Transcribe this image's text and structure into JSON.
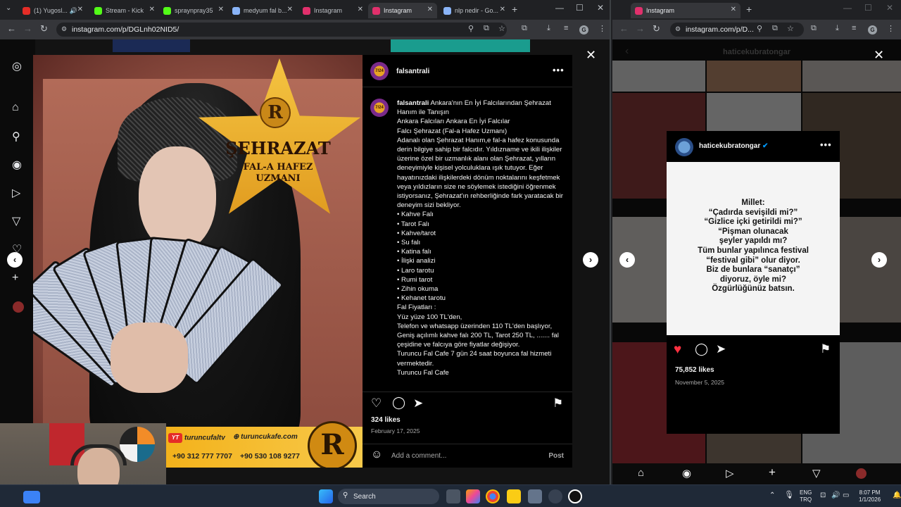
{
  "left_window": {
    "tabs": [
      {
        "label": "(1) Yugosl...",
        "color": "#e52d27",
        "audio": "🔊"
      },
      {
        "label": "Stream - Kick",
        "color": "#53fc18"
      },
      {
        "label": "spraynpray35",
        "color": "#53fc18"
      },
      {
        "label": "medyum fal b...",
        "color": "#8ab4f8"
      },
      {
        "label": "Instagram",
        "color": "#e1306c"
      },
      {
        "label": "Instagram",
        "color": "#e1306c"
      },
      {
        "label": "nlp nedir - Go...",
        "color": "#8ab4f8"
      }
    ],
    "url": "instagram.com/p/DGLnh02NID5/"
  },
  "post": {
    "username": "falsantrali",
    "avatar_text": "7/24",
    "image": {
      "brand_title": "ŞEHRAZAT",
      "brand_sub1": "FAL-A HAFEZ",
      "brand_sub2": "UZMANI",
      "logo_letter": "R",
      "youtube": "turuncufaltv",
      "web": "turuncukafe.com",
      "phone1": "+90 312 777 7707",
      "phone2": "+90 530 108 9277",
      "yt_label": "YT"
    },
    "caption_user": "falsantrali",
    "caption_first": "Ankara'nın En İyi Falcılarından Şehrazat Hanım ile Tanışın",
    "caption_lines": [
      "Ankara Falcıları Ankara En İyi Falcılar",
      "Falcı Şehrazat (Fal-a Hafez Uzmanı)",
      "Adanalı olan Şehrazat Hanım,e fal-a hafez konusunda derin bilgiye sahip bir falcıdır. Yıldızname ve ikili ilişkiler üzerine özel bir uzmanlık alanı olan Şehrazat, yılların deneyimiyle kişisel yolculuklara ışık tutuyor. Eğer hayatınızdaki ilişkilerdeki dönüm noktalarını keşfetmek veya yıldızların size ne söylemek istediğini öğrenmek istiyorsanız, Şehrazat'ın rehberliğinde fark yaratacak bir deneyim sizi bekliyor.",
      "• Kahve Falı",
      "• Tarot Falı",
      "• Kahve/tarot",
      "• Su falı",
      "• Katina falı",
      "• İlişki analizi",
      "• Laro tarotu",
      "• Rumi tarot",
      "• Zihin okuma",
      "• Kehanet tarotu",
      "Fal Fiyatları :",
      "Yüz yüze 100 TL'den,",
      "Telefon ve whatsapp üzerinden 110 TL'den başlıyor, Geniş açılımlı kahve falı 200 TL, Tarot 250 TL, ....... fal çeşidine ve falcıya göre fiyatlar değişiyor.",
      "Turuncu Fal Cafe 7 gün 24 saat boyunca fal hizmeti vermektedir.",
      "Turuncu Fal Cafe"
    ],
    "likes": "324 likes",
    "date": "February 17, 2025",
    "comment_placeholder": "Add a comment...",
    "post_label": "Post"
  },
  "right_window": {
    "tabs": [
      {
        "label": "Instagram",
        "color": "#e1306c"
      }
    ],
    "url": "instagram.com/p/D...",
    "profile_name": "haticekubratongar",
    "post_user": "haticekubratongar",
    "verified": "✔",
    "post_text_lines": [
      "Millet:",
      "“Çadırda sevişildi mi?”",
      "“Gizlice içki getirildi mi?”",
      "“Pişman olunacak",
      "şeyler yapıldı mı?",
      "Tüm bunlar yapılınca festival",
      "“festival gibi” olur diyor.",
      "Biz de bunlara “sanatçı”",
      "diyoruz, öyle mi?",
      "Özgürlüğünüz batsın."
    ],
    "likes": "75,852 likes",
    "date": "November 5, 2025"
  },
  "taskbar": {
    "search_label": "Search",
    "lang1": "ENG",
    "lang2": "TRQ",
    "time": "8:07 PM",
    "date": "1/1/2026"
  },
  "icons": {
    "back": "←",
    "forward": "→",
    "reload": "↻",
    "close": "✕",
    "plus": "+",
    "minimize": "—",
    "maximize": "☐",
    "heart": "♡",
    "heart_filled": "♥",
    "comment": "◯",
    "share": "➤",
    "bookmark": "⚑",
    "left_chev": "‹",
    "right_chev": "›",
    "dots": "•••",
    "smile": "☺",
    "zoom": "⚲",
    "star": "☆",
    "ext": "⧉",
    "download": "⤓",
    "menu": "⋮"
  },
  "colors": {
    "accent": "#0095f6",
    "like_red": "#ff3040",
    "ig_bg": "#000000"
  }
}
